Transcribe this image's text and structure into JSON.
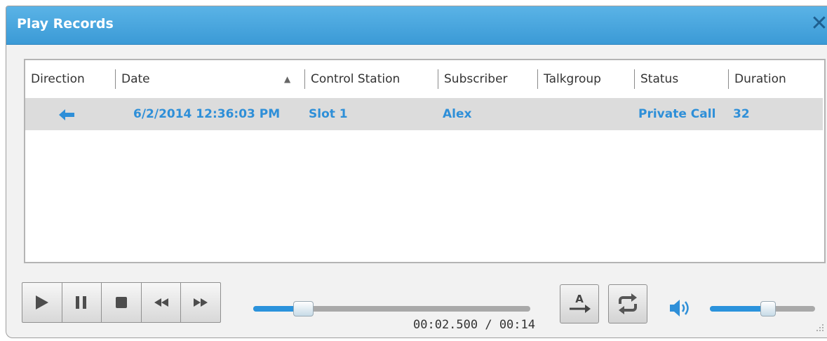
{
  "window": {
    "title": "Play Records",
    "close_glyph": "✕"
  },
  "table": {
    "columns": [
      "Direction",
      "Date",
      "Control Station",
      "Subscriber",
      "Talkgroup",
      "Status",
      "Duration"
    ],
    "sort_indicator": "▲",
    "rows": [
      {
        "direction_icon": "arrow-left-icon",
        "date": "6/2/2014 12:36:03 PM",
        "control_station": "Slot 1",
        "subscriber": "Alex",
        "talkgroup": "",
        "status": "Private Call",
        "duration": "32"
      }
    ]
  },
  "player": {
    "buttons": [
      "play-icon",
      "pause-icon",
      "stop-icon",
      "rewind-icon",
      "fast-forward-icon"
    ],
    "position_fraction": 0.18,
    "time_display": "00:02.500 / 00:14",
    "auto_button_label": "A",
    "volume_fraction": 0.55
  },
  "colors": {
    "title_bar": "#3b9ad6",
    "accent": "#2e8fd8",
    "selected_row": "#dcdcdc"
  }
}
